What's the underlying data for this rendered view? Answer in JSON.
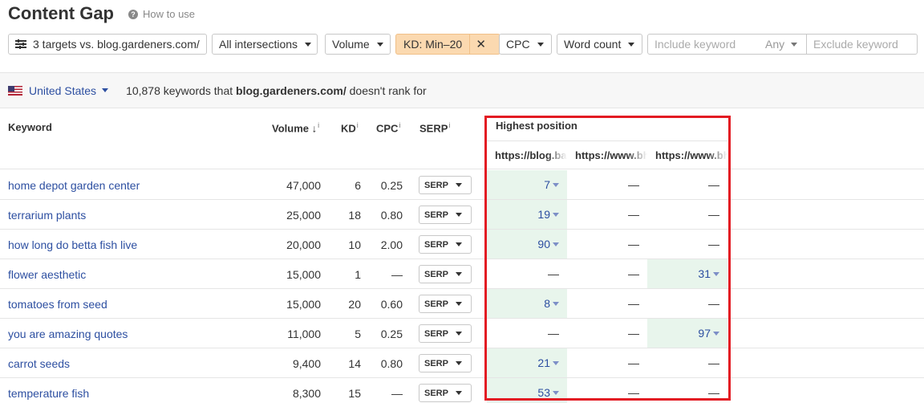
{
  "header": {
    "title": "Content Gap",
    "how_to_use": "How to use"
  },
  "filters": {
    "targets_label": "3 targets vs. blog.gardeners.com/",
    "intersections_label": "All intersections",
    "volume_label": "Volume",
    "kd_label": "KD: Min–20",
    "cpc_label": "CPC",
    "word_count_label": "Word count",
    "include_placeholder": "Include keyword",
    "any_label": "Any",
    "exclude_placeholder": "Exclude keyword"
  },
  "summary": {
    "country": "United States",
    "prefix": "10,878 keywords that ",
    "domain": "blog.gardeners.com/",
    "suffix": " doesn't rank for"
  },
  "table": {
    "headers": {
      "keyword": "Keyword",
      "volume": "Volume ↓",
      "kd": "KD",
      "cpc": "CPC",
      "serp": "SERP",
      "info": "i",
      "highest_position": "Highest position"
    },
    "targets": [
      "https://blog.backyardboss.net/",
      "https://www.bhg.com/",
      "https://www.bhg.com/gardening/"
    ],
    "serp_button": "SERP",
    "rows": [
      {
        "keyword": "home depot garden center",
        "volume": "47,000",
        "kd": "6",
        "cpc": "0.25",
        "pos": [
          "7",
          "—",
          "—"
        ]
      },
      {
        "keyword": "terrarium plants",
        "volume": "25,000",
        "kd": "18",
        "cpc": "0.80",
        "pos": [
          "19",
          "—",
          "—"
        ]
      },
      {
        "keyword": "how long do betta fish live",
        "volume": "20,000",
        "kd": "10",
        "cpc": "2.00",
        "pos": [
          "90",
          "—",
          "—"
        ]
      },
      {
        "keyword": "flower aesthetic",
        "volume": "15,000",
        "kd": "1",
        "cpc": "—",
        "pos": [
          "—",
          "—",
          "31"
        ]
      },
      {
        "keyword": "tomatoes from seed",
        "volume": "15,000",
        "kd": "20",
        "cpc": "0.60",
        "pos": [
          "8",
          "—",
          "—"
        ]
      },
      {
        "keyword": "you are amazing quotes",
        "volume": "11,000",
        "kd": "5",
        "cpc": "0.25",
        "pos": [
          "—",
          "—",
          "97"
        ]
      },
      {
        "keyword": "carrot seeds",
        "volume": "9,400",
        "kd": "14",
        "cpc": "0.80",
        "pos": [
          "21",
          "—",
          "—"
        ]
      },
      {
        "keyword": "temperature fish",
        "volume": "8,300",
        "kd": "15",
        "cpc": "—",
        "pos": [
          "53",
          "—",
          "—"
        ]
      }
    ]
  },
  "colors": {
    "link": "#2d4fa1",
    "kd_chip": "#fbd9b0",
    "ranked_cell": "#e8f5ec",
    "highlight_border": "#e31b23"
  },
  "icons": {
    "targets": "sliders-icon",
    "help": "question-circle-icon",
    "country": "us-flag-icon",
    "remove_filter": "close-icon",
    "dropdown": "caret-down-icon",
    "position_dropdown": "triangle-down-icon"
  }
}
